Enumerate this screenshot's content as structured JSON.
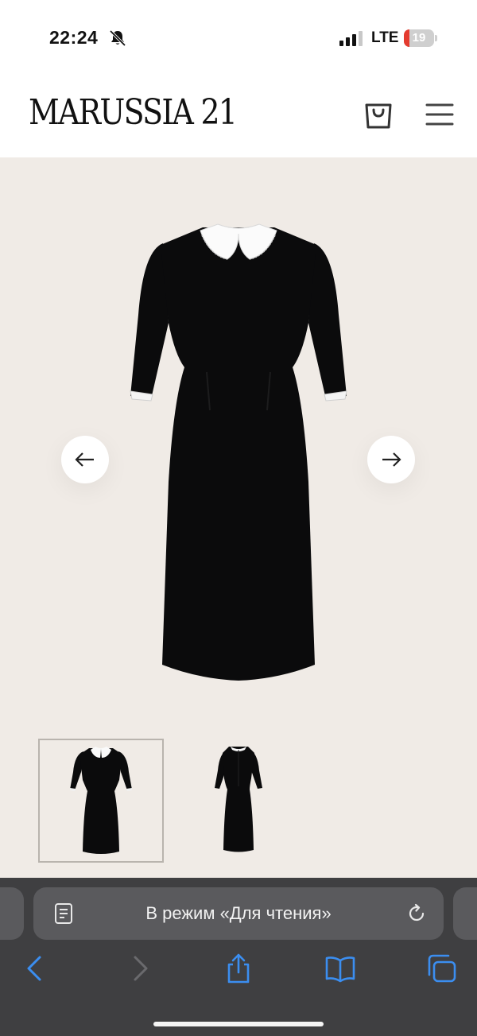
{
  "status_bar": {
    "time": "22:24",
    "network": "LTE",
    "battery_level": "19",
    "battery_fraction": 0.19,
    "battery_color": "#e43b2f",
    "icons": [
      "bell-slash-icon",
      "signal-icon",
      "battery-icon"
    ]
  },
  "header": {
    "logo_text": "MARUSSIA 21",
    "icons": [
      "shopping-bag-icon",
      "menu-icon"
    ]
  },
  "gallery": {
    "background_color": "#f0ebe6",
    "product_color": "#0b0b0c",
    "icons": [
      "arrow-left-icon",
      "arrow-right-icon"
    ],
    "thumbnail_count": 2,
    "active_thumbnail": 1
  },
  "browser": {
    "address_text": "В режим «Для чтения»",
    "accent_color": "#3b8ef0",
    "icons": [
      "reader-mode-icon",
      "reload-icon",
      "back-icon",
      "forward-icon",
      "share-icon",
      "bookmarks-icon",
      "tabs-icon"
    ]
  }
}
